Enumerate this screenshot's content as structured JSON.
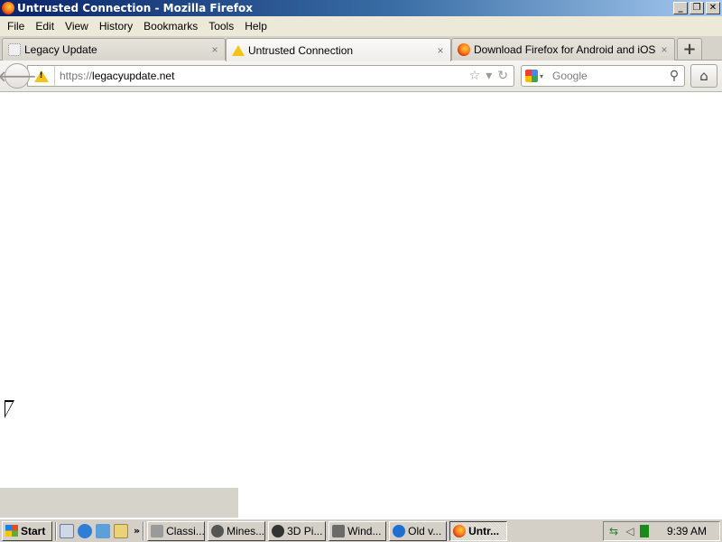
{
  "window": {
    "title": "Untrusted Connection - Mozilla Firefox",
    "controls": {
      "minimize": "_",
      "restore": "❐",
      "close": "✕"
    }
  },
  "menubar": {
    "items": [
      {
        "label": "File"
      },
      {
        "label": "Edit"
      },
      {
        "label": "View"
      },
      {
        "label": "History"
      },
      {
        "label": "Bookmarks"
      },
      {
        "label": "Tools"
      },
      {
        "label": "Help"
      }
    ]
  },
  "tabs": [
    {
      "label": "Legacy Update",
      "icon": "blank-page-icon",
      "active": false
    },
    {
      "label": "Untrusted Connection",
      "icon": "warning-icon",
      "active": true
    },
    {
      "label": "Download Firefox for Android and iOS",
      "icon": "firefox-icon",
      "active": false
    }
  ],
  "tab_close_glyph": "×",
  "newtab_glyph": "+",
  "navbar": {
    "back_glyph": "🡐",
    "url_protocol": "https://",
    "url_host": "legacyupdate.net",
    "star_glyph": "☆",
    "dropdown_glyph": "▾",
    "reload_glyph": "↻",
    "search_placeholder": "Google",
    "search_glyph": "⚲",
    "home_glyph": "⌂"
  },
  "taskbar": {
    "start_label": "Start",
    "quick_launch_more": "»",
    "tasks": [
      {
        "label": "Classi...",
        "active": false,
        "color": "#9a9a9a"
      },
      {
        "label": "Mines...",
        "active": false,
        "color": "#555555"
      },
      {
        "label": "3D Pi...",
        "active": false,
        "color": "#333333"
      },
      {
        "label": "Wind...",
        "active": false,
        "color": "#6a6a6a"
      },
      {
        "label": "Old v...",
        "active": false,
        "color": "#1e6fd1"
      },
      {
        "label": "Untr...",
        "active": true,
        "color": "#e0661a"
      }
    ],
    "clock": "9:39 AM"
  },
  "colors": {
    "titlebar_start": "#0a246a",
    "titlebar_end": "#a6caf0",
    "chrome": "#d4d0c8",
    "warning": "#f3c319"
  }
}
